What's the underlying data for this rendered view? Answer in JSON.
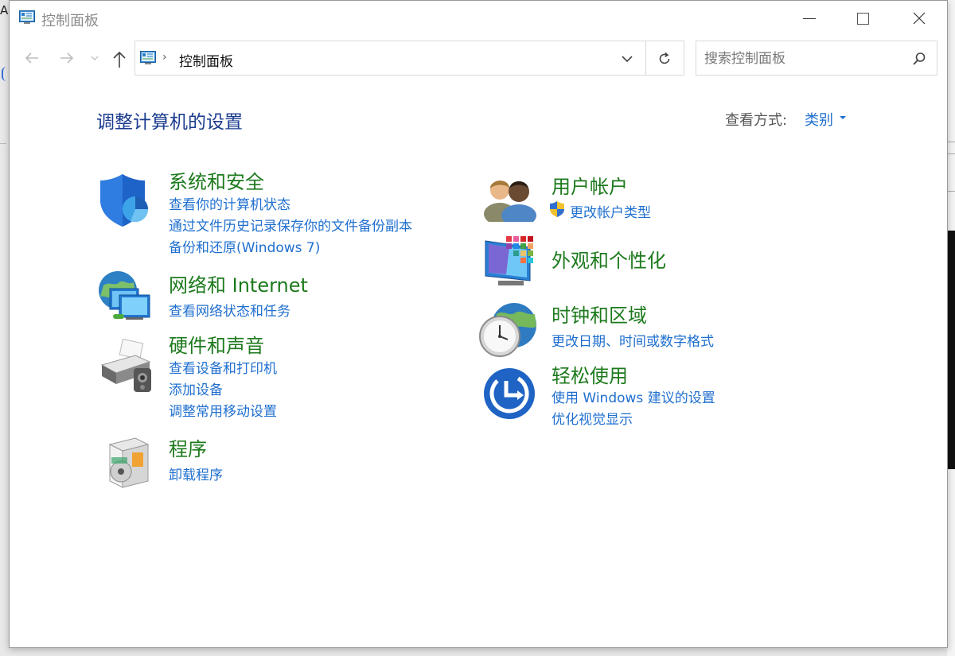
{
  "window": {
    "title": "控制面板"
  },
  "address": {
    "path": "控制面板",
    "separator": "›"
  },
  "search": {
    "placeholder": "搜索控制面板"
  },
  "main": {
    "heading": "调整计算机的设置",
    "view_by_label": "查看方式:",
    "view_by_value": "类别"
  },
  "categories": {
    "system_security": {
      "title": "系统和安全",
      "links": [
        "查看你的计算机状态",
        "通过文件历史记录保存你的文件备份副本",
        "备份和还原(Windows 7)"
      ],
      "icon": "shield-icon"
    },
    "network": {
      "title": "网络和 Internet",
      "links": [
        "查看网络状态和任务"
      ],
      "icon": "network-globe-icon"
    },
    "hardware": {
      "title": "硬件和声音",
      "links": [
        "查看设备和打印机",
        "添加设备",
        "调整常用移动设置"
      ],
      "icon": "printer-icon"
    },
    "programs": {
      "title": "程序",
      "links": [
        "卸载程序"
      ],
      "icon": "programs-box-icon"
    },
    "user_accounts": {
      "title": "用户帐户",
      "links": [
        "更改帐户类型"
      ],
      "icon": "users-icon"
    },
    "appearance": {
      "title": "外观和个性化",
      "links": [],
      "icon": "monitor-palette-icon"
    },
    "clock_region": {
      "title": "时钟和区域",
      "links": [
        "更改日期、时间或数字格式"
      ],
      "icon": "clock-globe-icon"
    },
    "ease_of_access": {
      "title": "轻松使用",
      "links": [
        "使用 Windows 建议的设置",
        "优化视觉显示"
      ],
      "icon": "ease-of-access-icon"
    }
  },
  "colors": {
    "category_title": "#1d7a1d",
    "link": "#1f6fcf",
    "heading": "#1b3c8f"
  }
}
